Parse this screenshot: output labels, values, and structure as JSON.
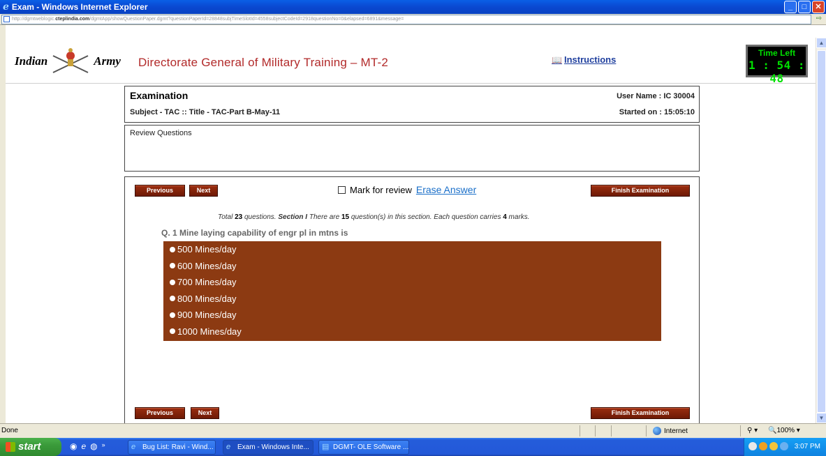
{
  "window": {
    "title": "Exam - Windows Internet Explorer",
    "url_prefix": "http://dgmtweblogic.",
    "url_domain": "cteplindia.com",
    "url_rest": "/dgmtApp/showQuestionPaper.dgmt?questionPaperId=28848subjTimeSlotId=4558subjectCodeId=2918questionNo=0&elapsed=6891&message="
  },
  "header": {
    "logo_word1": "Indian",
    "logo_word2": "Army",
    "org_title": "Directorate General of Military Training – MT-2",
    "instructions_link": "Instructions",
    "timer_label": "Time Left",
    "timer_value": "1 : 54 : 48"
  },
  "exam": {
    "heading": "Examination",
    "subject_line": "Subject - TAC :: Title - TAC-Part B-May-11",
    "user_name": "User Name : IC 30004",
    "started_on": "Started on : 15:05:10",
    "review_title": "Review Questions"
  },
  "controls": {
    "previous": "Previous",
    "next": "Next",
    "mark_for_review": "Mark for review",
    "erase_answer": "Erase Answer",
    "finish": "Finish Examination"
  },
  "summary": {
    "pre1": "Total ",
    "total": "23",
    "pre2": " questions. ",
    "section": "Section I",
    "pre3": " There are ",
    "section_count": "15",
    "pre4": " question(s) in this section. Each question carries ",
    "marks": "4",
    "pre5": " marks."
  },
  "question": {
    "text": "Q. 1  Mine laying capability of engr pl in mtns is",
    "options": [
      "500 Mines/day",
      "600 Mines/day",
      "700 Mines/day",
      "800 Mines/day",
      "900 Mines/day",
      "1000 Mines/day"
    ]
  },
  "statusbar": {
    "status": "Done",
    "zone": "Internet",
    "zoom": "100%"
  },
  "taskbar": {
    "start": "start",
    "items": [
      "Bug List: Ravi - Wind...",
      "Exam - Windows Inte...",
      "DGMT- OLE Software ..."
    ],
    "clock": "3:07 PM"
  },
  "colors": {
    "brand_red": "#b22a2a",
    "button_brown": "#8c3a12",
    "timer_green": "#00e000",
    "link_blue": "#1a6fc9"
  }
}
